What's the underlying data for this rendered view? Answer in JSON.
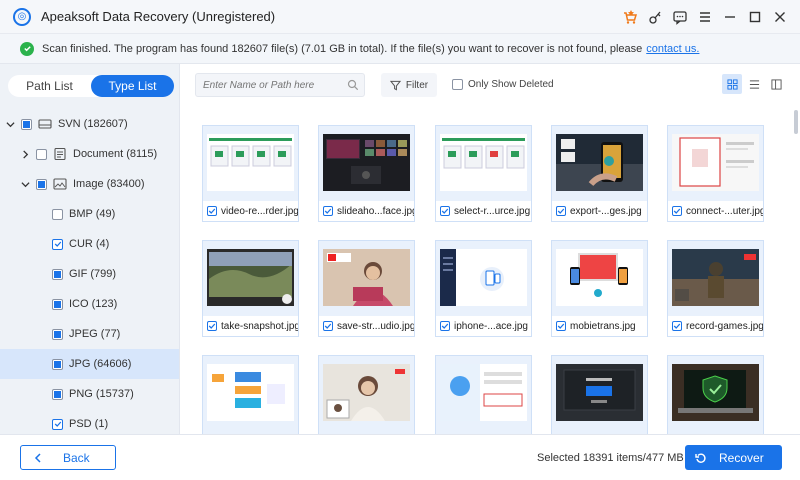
{
  "window": {
    "title": "Apeaksoft Data Recovery (Unregistered)"
  },
  "status": {
    "message": "Scan finished. The program has found 182607 file(s) (7.01 GB in total). If the file(s) you want to recover is not found, please",
    "link": "contact us.",
    "color": "#2bb24c"
  },
  "tabs": {
    "path_list": "Path List",
    "type_list": "Type List",
    "active": "type_list"
  },
  "tree": {
    "root": "SVN (182607)",
    "document": "Document (8115)",
    "image": "Image (83400)",
    "types": [
      {
        "label": "BMP (49)",
        "state": "empty"
      },
      {
        "label": "CUR (4)",
        "state": "checked"
      },
      {
        "label": "GIF (799)",
        "state": "partial"
      },
      {
        "label": "ICO (123)",
        "state": "partial"
      },
      {
        "label": "JPEG (77)",
        "state": "partial"
      },
      {
        "label": "JPG (64606)",
        "state": "partial"
      },
      {
        "label": "PNG (15737)",
        "state": "partial"
      },
      {
        "label": "PSD (1)",
        "state": "checked"
      }
    ]
  },
  "toolbar": {
    "search_placeholder": "Enter Name or Path here",
    "filter_label": "Filter",
    "only_deleted_label": "Only Show Deleted"
  },
  "files": [
    {
      "name": "video-re...rder.jpg",
      "thumb": "ui-screens"
    },
    {
      "name": "slideaho...face.jpg",
      "thumb": "dark-gallery"
    },
    {
      "name": "select-r...urce.jpg",
      "thumb": "ui-screens-red"
    },
    {
      "name": "export-...ges.jpg",
      "thumb": "phone-hand"
    },
    {
      "name": "connect-...uter.jpg",
      "thumb": "dialog-red"
    },
    {
      "name": "take-snapshot.jpg",
      "thumb": "monitor-landscape"
    },
    {
      "name": "save-str...udio.jpg",
      "thumb": "youtube-woman"
    },
    {
      "name": "iphone-...ace.jpg",
      "thumb": "phone-connect"
    },
    {
      "name": "mobietrans.jpg",
      "thumb": "devices"
    },
    {
      "name": "record-games.jpg",
      "thumb": "game-soldier"
    },
    {
      "name": "",
      "thumb": "flowchart"
    },
    {
      "name": "",
      "thumb": "woman-video-call"
    },
    {
      "name": "",
      "thumb": "blue-dialog"
    },
    {
      "name": "",
      "thumb": "dark-app"
    },
    {
      "name": "",
      "thumb": "laptop-shield"
    }
  ],
  "bottom": {
    "back_label": "Back",
    "selected_info": "Selected 18391 items/477 MB",
    "recover_label": "Recover"
  },
  "colors": {
    "accent": "#1a73e8",
    "panel": "#eef2f7"
  }
}
